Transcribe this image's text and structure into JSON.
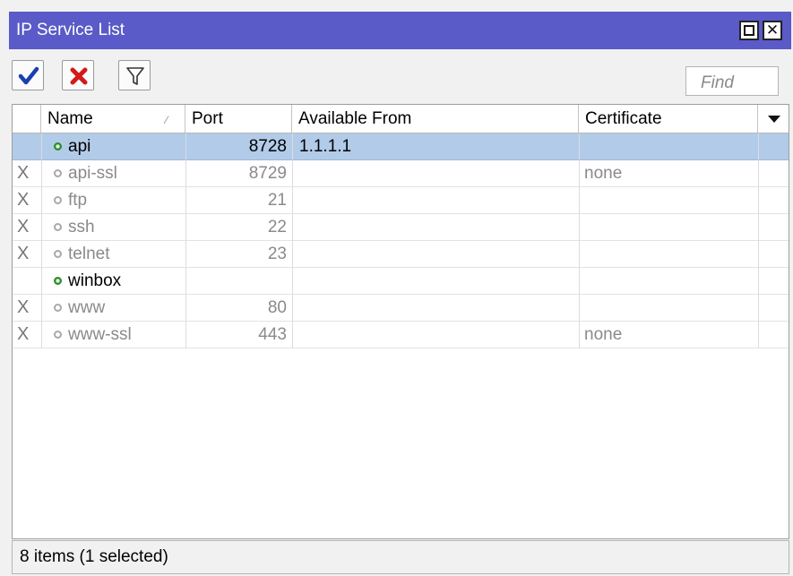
{
  "window": {
    "title": "IP Service List"
  },
  "toolbar": {
    "enable_icon": "check-icon",
    "disable_icon": "x-icon",
    "filter_icon": "funnel-icon",
    "find_placeholder": "Find",
    "colors": {
      "check": "#1a3fb0",
      "x": "#d21a1a"
    }
  },
  "table": {
    "columns": [
      "Name",
      "Port",
      "Available From",
      "Certificate"
    ],
    "rows": [
      {
        "flag": "",
        "name": "api",
        "port": "8728",
        "from": "1.1.1.1",
        "cert": "",
        "enabled": true,
        "selected": true
      },
      {
        "flag": "X",
        "name": "api-ssl",
        "port": "8729",
        "from": "",
        "cert": "none",
        "enabled": false,
        "selected": false
      },
      {
        "flag": "X",
        "name": "ftp",
        "port": "21",
        "from": "",
        "cert": "",
        "enabled": false,
        "selected": false
      },
      {
        "flag": "X",
        "name": "ssh",
        "port": "22",
        "from": "",
        "cert": "",
        "enabled": false,
        "selected": false
      },
      {
        "flag": "X",
        "name": "telnet",
        "port": "23",
        "from": "",
        "cert": "",
        "enabled": false,
        "selected": false
      },
      {
        "flag": "",
        "name": "winbox",
        "port": "",
        "from": "",
        "cert": "",
        "enabled": true,
        "selected": false
      },
      {
        "flag": "X",
        "name": "www",
        "port": "80",
        "from": "",
        "cert": "",
        "enabled": false,
        "selected": false
      },
      {
        "flag": "X",
        "name": "www-ssl",
        "port": "443",
        "from": "",
        "cert": "none",
        "enabled": false,
        "selected": false
      }
    ]
  },
  "status": {
    "text": "8 items (1 selected)"
  }
}
